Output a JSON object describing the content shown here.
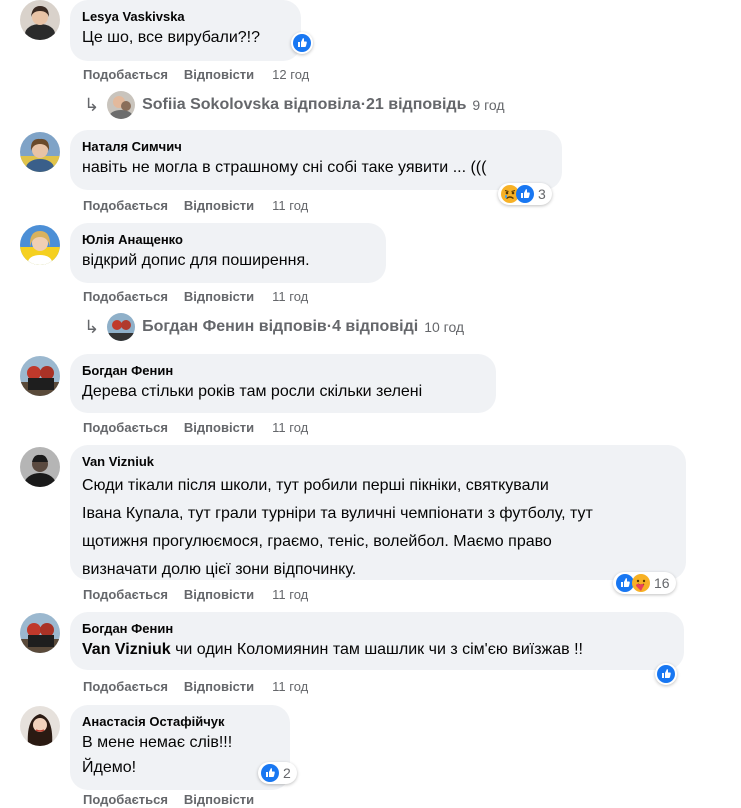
{
  "action_like": "Подобається",
  "action_reply": "Відповісти",
  "colors": {
    "bubble": "#f0f2f5",
    "meta": "#65676b",
    "like_blue": "#1877f2"
  },
  "comments": [
    {
      "author": "Lesya Vaskivska",
      "text": "Це шо, все вирубали?!?",
      "time": "12 год",
      "reactions": [
        "like-icon"
      ],
      "count": ""
    },
    {
      "author": "Наталя Симчич",
      "text": "навіть не могла в страшному сні собі таке уявити ... (((",
      "time": "11 год",
      "reactions": [
        "sad-icon",
        "like-icon"
      ],
      "count": "3"
    },
    {
      "author": "Юлія Анащенко",
      "text": "відкрий допис для поширення.",
      "time": "11 год",
      "reactions": [],
      "count": ""
    },
    {
      "author": "Богдан Фенин",
      "text": "Дерева стільки років там росли скільки зелені",
      "time": "11 год",
      "reactions": [],
      "count": ""
    },
    {
      "author": "Van Vizniuk",
      "lines": [
        "Сюди тікали після школи, тут робили перші пікніки, святкували",
        "Івана Купала, тут грали турніри та вуличні чемпіонати з футболу, тут",
        "щотижня прогулюємося, граємо, теніс, волейбол. Маємо право",
        "визначати долю цієї зони відпочинку."
      ],
      "time": "11 год",
      "reactions": [
        "like-icon",
        "care-icon"
      ],
      "count": "16"
    },
    {
      "author": "Богдан Фенин",
      "mention": "Van Vizniuk",
      "text": " чи один Коломиянин там шашлик чи з сім'єю виїзжав !!",
      "time": "11 год",
      "reactions": [
        "like-icon"
      ],
      "count": ""
    },
    {
      "author": "Анастасія Остафійчук",
      "lines": [
        "В мене немає слів!!!",
        "Йдемо!"
      ],
      "time": "",
      "reactions": [
        "like-icon"
      ],
      "count": "2"
    }
  ],
  "reply_threads": [
    {
      "name": "Sofiia Sokolovska відповіла",
      "sep": " · ",
      "count": "21 відповідь",
      "time": "9 год",
      "icon": "reply-arrow-icon"
    },
    {
      "name": "Богдан Фенин відповів",
      "sep": " · ",
      "count": "4 відповіді",
      "time": "10 год",
      "icon": "reply-arrow-icon"
    }
  ]
}
